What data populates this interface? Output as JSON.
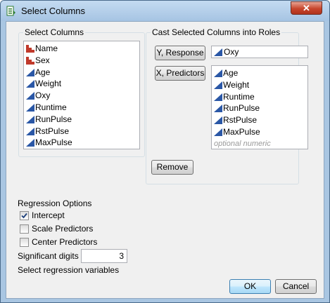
{
  "window": {
    "title": "Select Columns",
    "close_label": "✕"
  },
  "select_columns": {
    "title": "Select Columns",
    "items": [
      {
        "label": "Name",
        "icon": "nominal-icon"
      },
      {
        "label": "Sex",
        "icon": "nominal-icon"
      },
      {
        "label": "Age",
        "icon": "continuous-icon"
      },
      {
        "label": "Weight",
        "icon": "continuous-icon"
      },
      {
        "label": "Oxy",
        "icon": "continuous-icon"
      },
      {
        "label": "Runtime",
        "icon": "continuous-icon"
      },
      {
        "label": "RunPulse",
        "icon": "continuous-icon"
      },
      {
        "label": "RstPulse",
        "icon": "continuous-icon"
      },
      {
        "label": "MaxPulse",
        "icon": "continuous-icon"
      }
    ]
  },
  "cast_roles": {
    "title": "Cast Selected Columns into Roles",
    "y_button": "Y, Response",
    "y_value": "Oxy",
    "x_button": "X, Predictors",
    "x_items": [
      "Age",
      "Weight",
      "Runtime",
      "RunPulse",
      "RstPulse",
      "MaxPulse"
    ],
    "x_placeholder": "optional numeric",
    "remove_button": "Remove"
  },
  "regression": {
    "title": "Regression Options",
    "intercept_label": "Intercept",
    "intercept_checked": true,
    "scale_label": "Scale Predictors",
    "scale_checked": false,
    "center_label": "Center Predictors",
    "center_checked": false,
    "sig_digits_label": "Significant digits",
    "sig_digits_value": "3",
    "status": "Select regression variables"
  },
  "footer": {
    "ok": "OK",
    "cancel": "Cancel"
  },
  "colors": {
    "nominal": "#c0392b",
    "continuous": "#2a57a6",
    "title_bg": "#a9c6e2",
    "close": "#c7452c"
  }
}
